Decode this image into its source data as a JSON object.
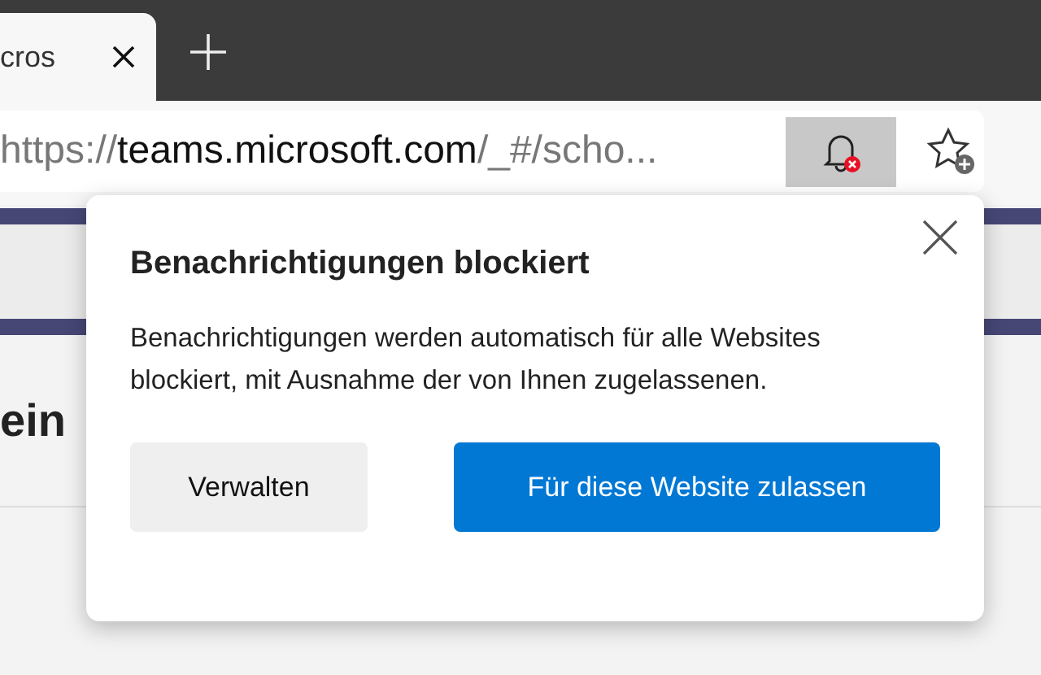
{
  "tab": {
    "title": "cros",
    "selected": true
  },
  "address_bar": {
    "scheme": "https://",
    "host": "teams.microsoft.com",
    "path": "/_#/scho..."
  },
  "notification_button": {
    "blocked": true,
    "selected": true
  },
  "page": {
    "heading": "ein"
  },
  "popup": {
    "title": "Benachrichtigungen blockiert",
    "message": "Benachrichtigungen werden automatisch für alle Websites blockiert, mit Ausnahme der von Ihnen zugelassenen.",
    "buttons": [
      {
        "label": "Verwalten",
        "kind": "secondary"
      },
      {
        "label": "Für diese Website zulassen",
        "kind": "primary"
      }
    ]
  }
}
